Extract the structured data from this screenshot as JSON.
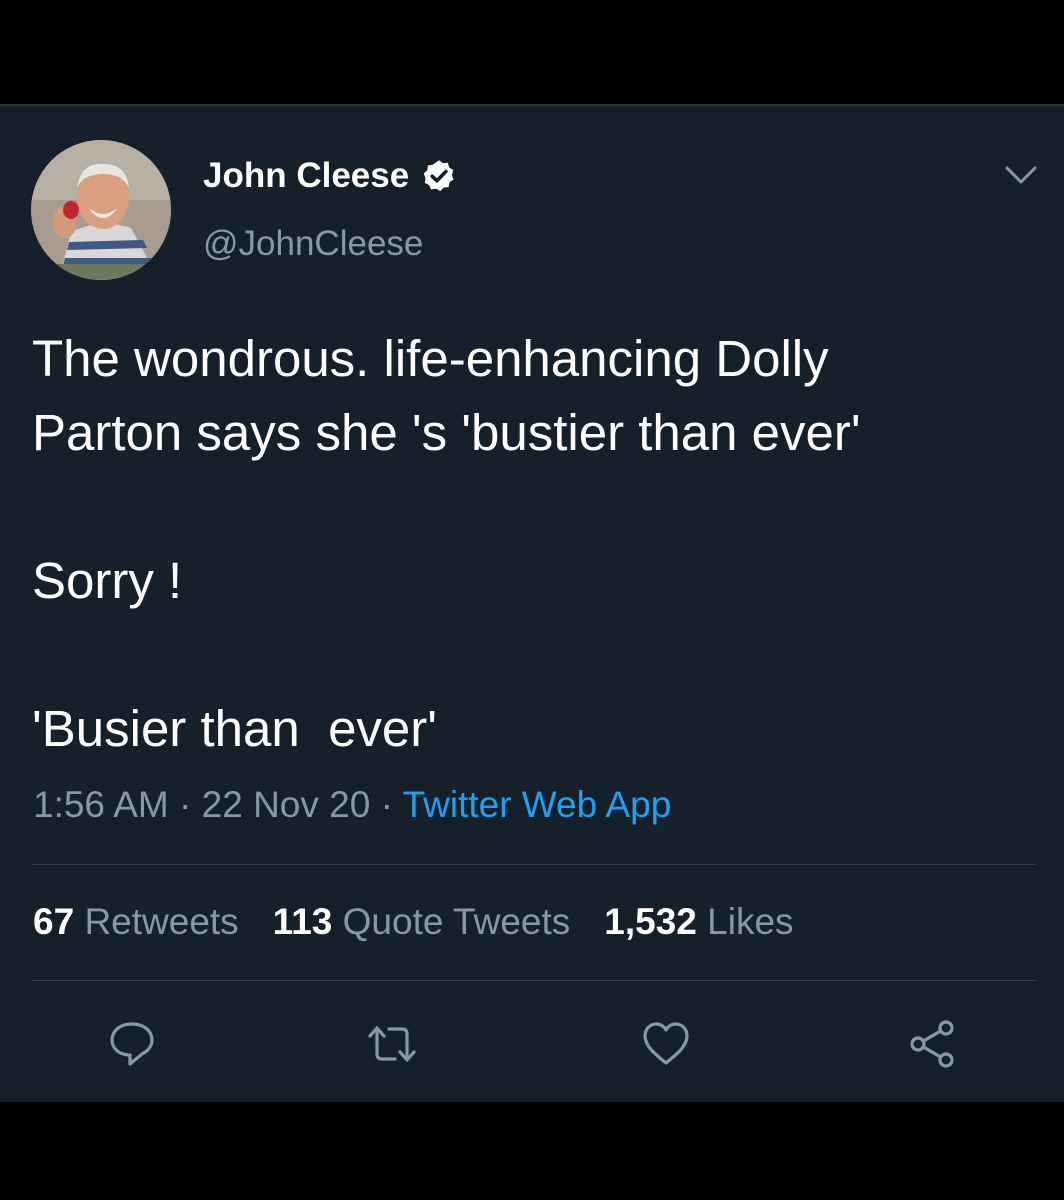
{
  "tweet": {
    "author": {
      "display_name": "John Cleese",
      "handle": "@JohnCleese",
      "verified": true
    },
    "text": "The wondrous. life-enhancing Dolly\nParton says she 's 'bustier than ever'\n\nSorry !\n\n'Busier than  ever'",
    "time": "1:56 AM",
    "separator": "·",
    "date": "22 Nov 20",
    "source": "Twitter Web App",
    "stats": [
      {
        "count": "67",
        "label": "Retweets"
      },
      {
        "count": "113",
        "label": "Quote Tweets"
      },
      {
        "count": "1,532",
        "label": "Likes"
      }
    ],
    "actions": [
      "reply-icon",
      "retweet-icon",
      "like-icon",
      "share-icon"
    ]
  },
  "colors": {
    "background": "#15202b",
    "text": "#ffffff",
    "secondary_text": "#8899a6",
    "link": "#1da1f2",
    "divider": "#38444d"
  }
}
